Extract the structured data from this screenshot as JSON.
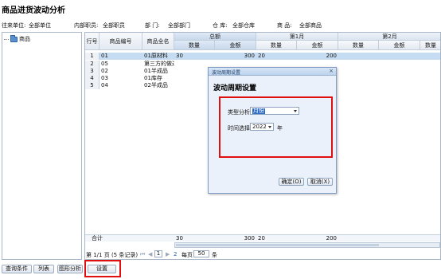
{
  "title": "商品进货波动分析",
  "filters": [
    {
      "label": "往来单位:",
      "value": "全部单位"
    },
    {
      "label": "内部职员:",
      "value": "全部职员"
    },
    {
      "label": "部 门:",
      "value": "全部部门"
    },
    {
      "label": "仓 库:",
      "value": "全部仓库"
    },
    {
      "label": "商 品:",
      "value": "全部商品"
    }
  ],
  "tree": {
    "root_label": "商品"
  },
  "grid": {
    "group_headers": [
      "总额",
      "第1月",
      "第2月"
    ],
    "headers": {
      "rowno": "行号",
      "code": "商品编号",
      "name": "商品全名",
      "qty": "数量",
      "amount": "金额"
    },
    "rows": [
      {
        "no": "1",
        "code": "01",
        "name": "01原材料",
        "total_qty": "30",
        "total_amount": "300",
        "m1_qty": "20",
        "m1_amount": "200"
      },
      {
        "no": "2",
        "code": "05",
        "name": "第三方的做过",
        "total_qty": "",
        "total_amount": "",
        "m1_qty": "",
        "m1_amount": ""
      },
      {
        "no": "3",
        "code": "02",
        "name": "01半成品",
        "total_qty": "",
        "total_amount": "",
        "m1_qty": "",
        "m1_amount": ""
      },
      {
        "no": "4",
        "code": "03",
        "name": "01库存",
        "total_qty": "",
        "total_amount": "",
        "m1_qty": "",
        "m1_amount": ""
      },
      {
        "no": "5",
        "code": "04",
        "name": "02半成品",
        "total_qty": "",
        "total_amount": "",
        "m1_qty": "",
        "m1_amount": ""
      }
    ],
    "totals": {
      "label": "合计",
      "total_qty": "30",
      "total_amount": "300",
      "m1_qty": "20",
      "m1_amount": "200"
    }
  },
  "pager": {
    "info": "第 1/1 页 (5 条记录)",
    "first": "⏮",
    "prev": "◀",
    "current_page": "1",
    "next": "▶",
    "last": "⏭",
    "refresh": "2",
    "per_page_label": "每页",
    "per_page": "50",
    "per_page_unit": "条"
  },
  "buttons": {
    "query": "查询条件",
    "list": "列表",
    "chart": "图形分析",
    "settings": "设置"
  },
  "dialog": {
    "titlebar": "波动周期设置",
    "close": "×",
    "heading": "波动周期设置",
    "type_label": "类型分析",
    "type_value": "月份",
    "year_label": "时间选择",
    "year_value": "2022",
    "year_unit": "年",
    "ok": "确定(O)",
    "cancel": "取消(X)"
  },
  "colors": {
    "highlight": "#e01010",
    "selected_row": "#c6dcf3",
    "accent": "#2f6dc4"
  }
}
